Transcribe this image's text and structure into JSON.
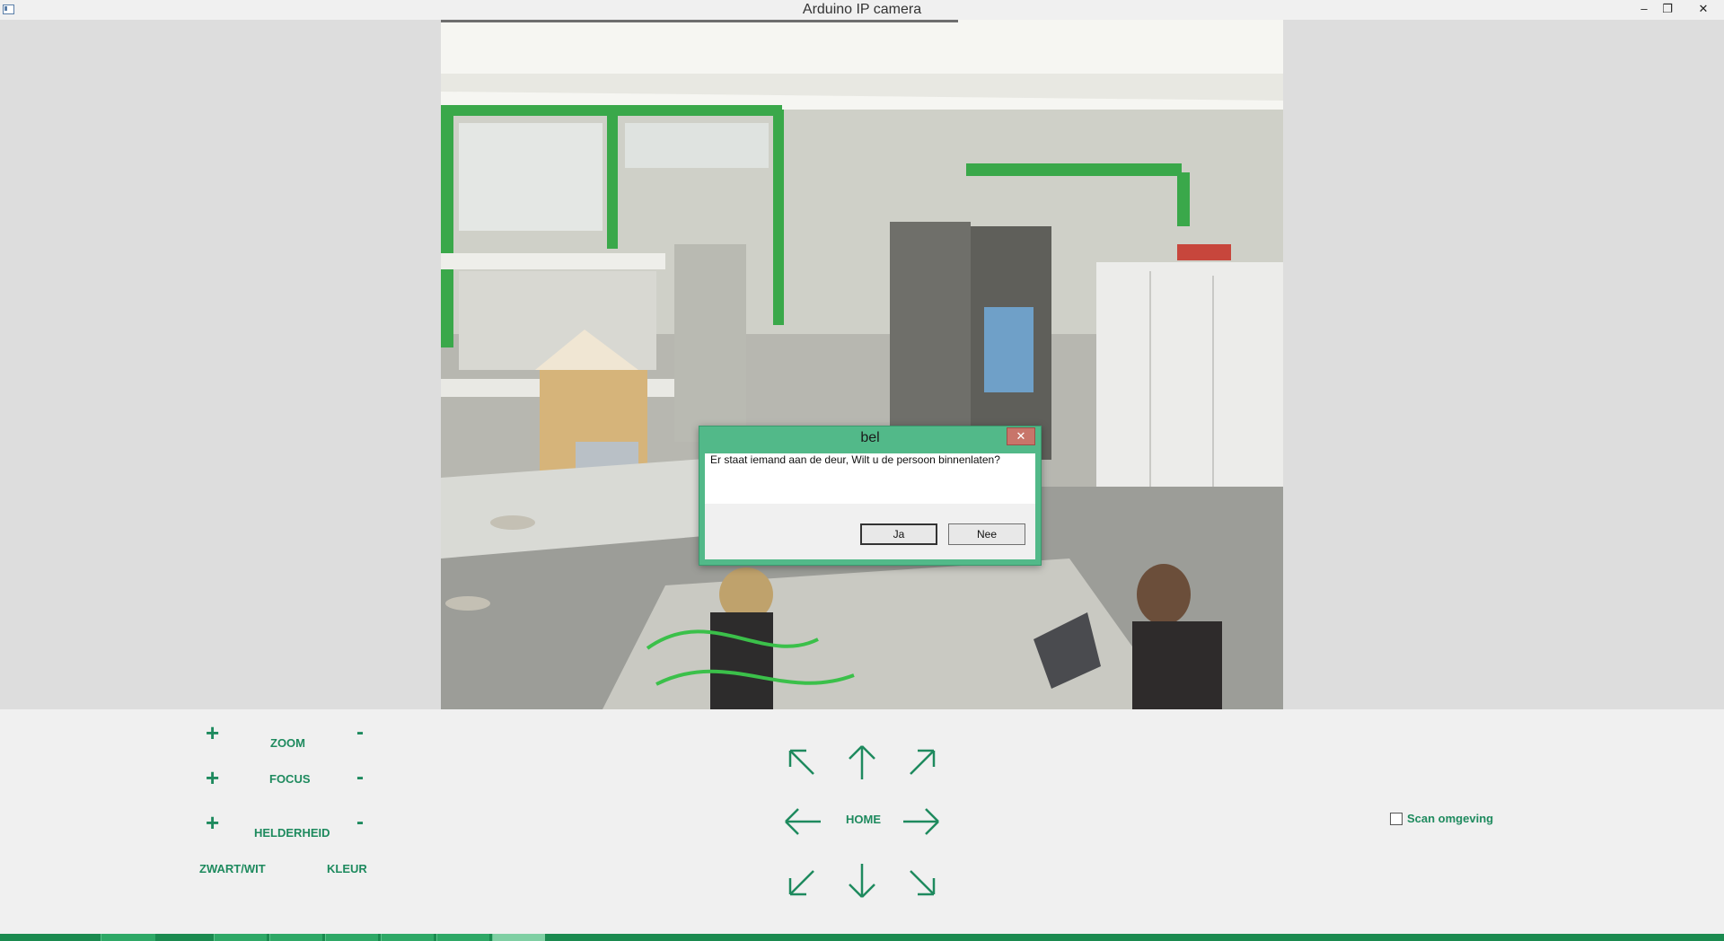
{
  "window": {
    "title": "Arduino IP camera",
    "minimize_glyph": "–",
    "restore_glyph": "❐",
    "close_glyph": "✕"
  },
  "camera": {
    "description_icon": "camera-feed"
  },
  "controls": {
    "zoom": {
      "label": "ZOOM",
      "plus": "+",
      "minus": "-"
    },
    "focus": {
      "label": "FOCUS",
      "plus": "+",
      "minus": "-"
    },
    "brightness": {
      "label": "HELDERHEID",
      "plus": "+",
      "minus": "-"
    },
    "bw_label": "ZWART/WIT",
    "color_label": "KLEUR",
    "home_label": "HOME",
    "scan_label": "Scan omgeving",
    "scan_checked": false
  },
  "dialog": {
    "title": "bel",
    "close_glyph": "✕",
    "message": "Er staat iemand aan de deur, Wilt u de persoon binnenlaten?",
    "yes_label": "Ja",
    "no_label": "Nee"
  },
  "colors": {
    "accent": "#1e8a5e",
    "dialog_frame": "#52b989",
    "taskbar": "#1a8a4f"
  }
}
